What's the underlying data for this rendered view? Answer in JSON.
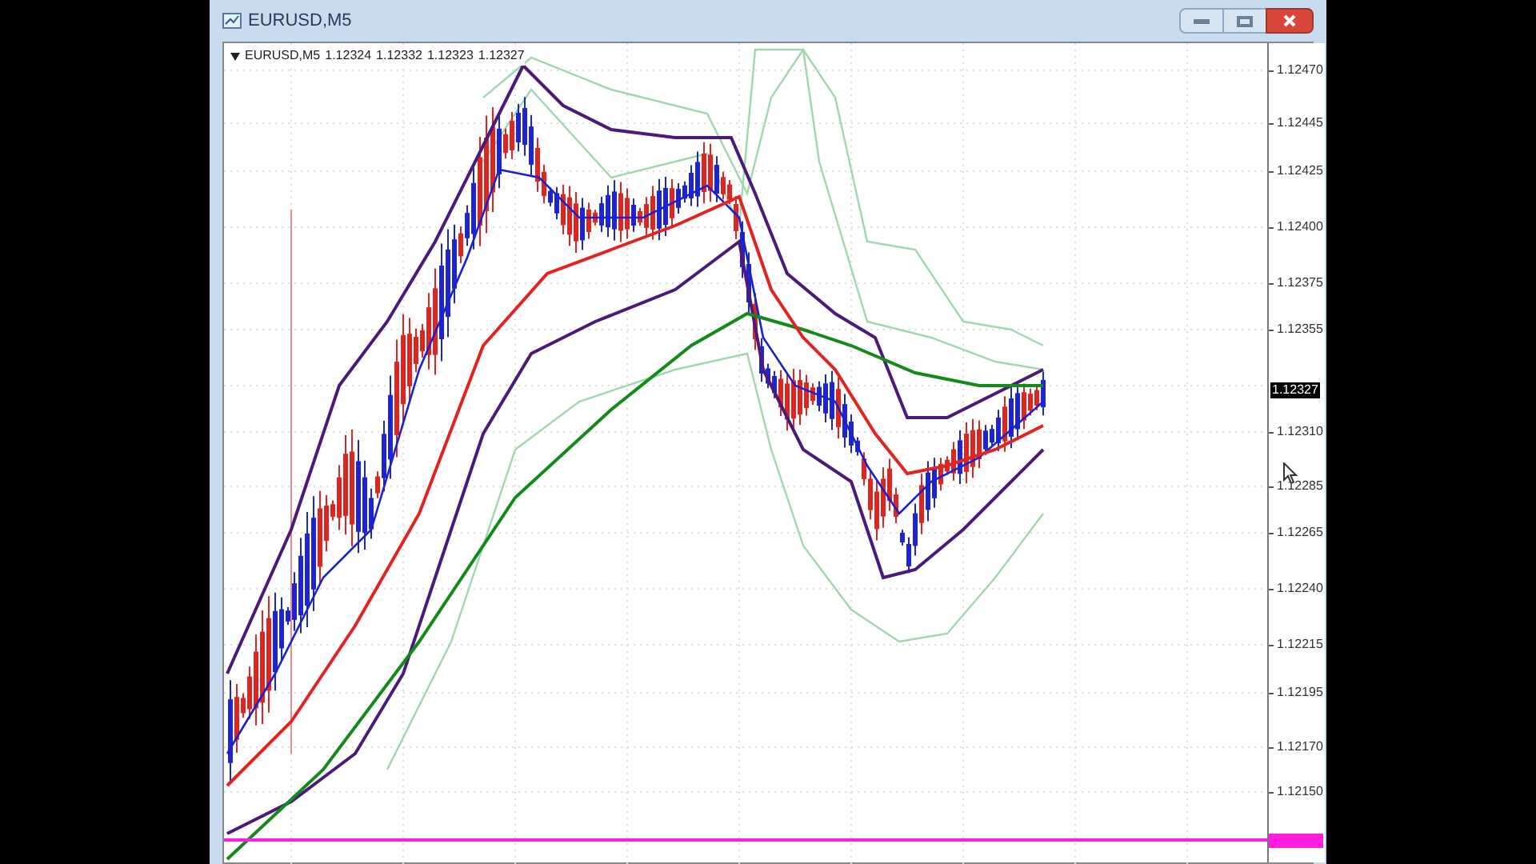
{
  "window": {
    "title": "EURUSD,M5"
  },
  "chart": {
    "symbol": "EURUSD,M5",
    "ohlc": [
      "1.12324",
      "1.12332",
      "1.12323",
      "1.12327"
    ],
    "price_axis": [
      "1.12470",
      "1.12445",
      "1.12425",
      "1.12400",
      "1.12375",
      "1.12355",
      "1.12310",
      "1.12285",
      "1.12265",
      "1.12240",
      "1.12215",
      "1.12195",
      "1.12170",
      "1.12150"
    ],
    "current_price": "1.12327"
  }
}
